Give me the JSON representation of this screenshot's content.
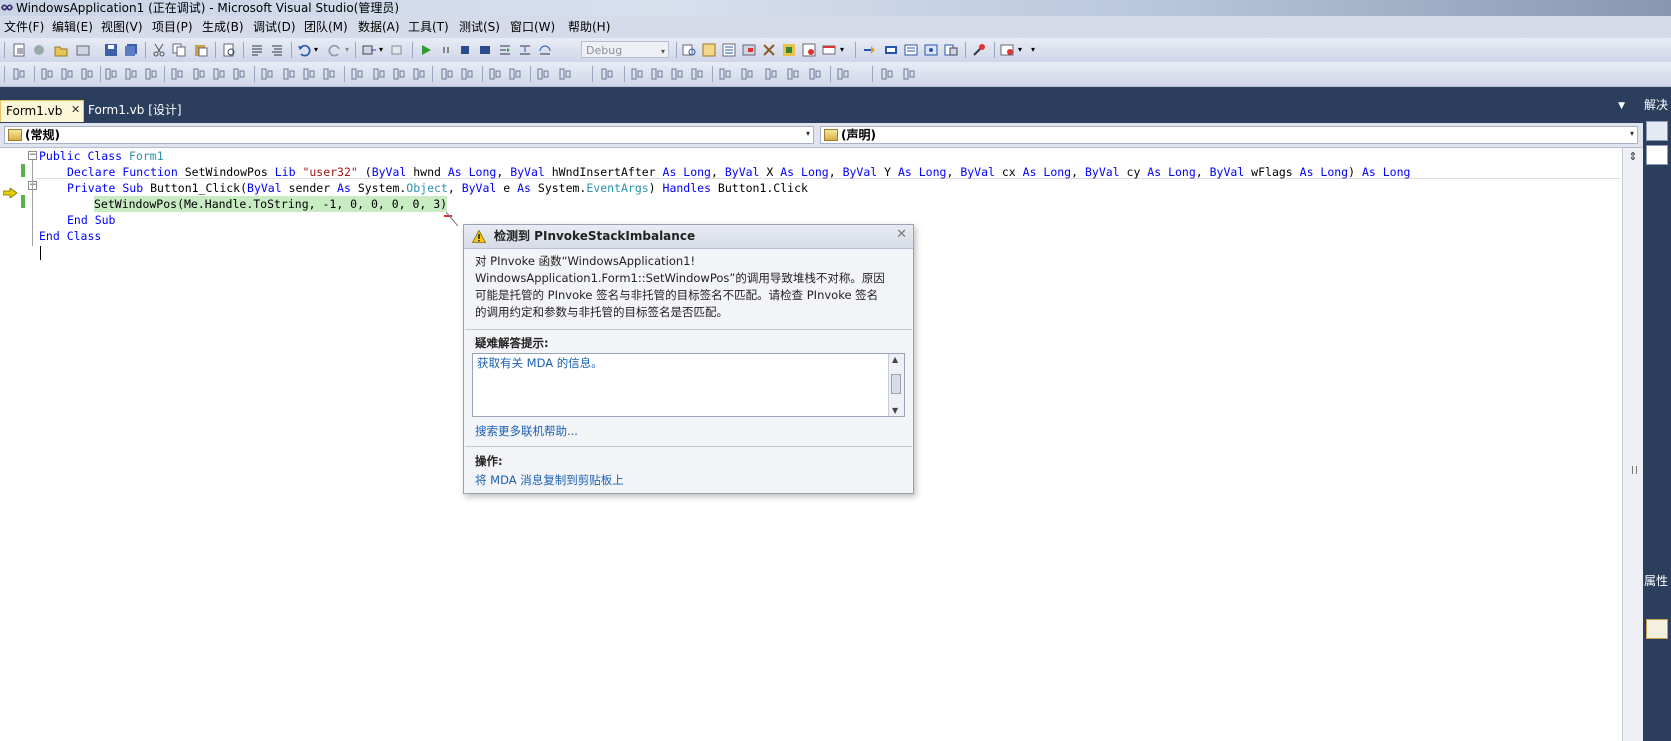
{
  "window": {
    "title": "WindowsApplication1 (正在调试) - Microsoft Visual Studio(管理员)"
  },
  "menu": {
    "items": [
      "文件(F)",
      "编辑(E)",
      "视图(V)",
      "项目(P)",
      "生成(B)",
      "调试(D)",
      "团队(M)",
      "数据(A)",
      "工具(T)",
      "测试(S)",
      "窗口(W)",
      "帮助(H)"
    ]
  },
  "toolbar": {
    "config_value": "Debug"
  },
  "tabs": [
    {
      "label": "Form1.vb"
    },
    {
      "label": "Form1.vb [设计]"
    }
  ],
  "right_panel": {
    "solution_tab": "解决",
    "properties_tab": "属性"
  },
  "navbar": {
    "left_value": "(常规)",
    "right_value": "(声明)"
  },
  "code": {
    "l1": {
      "kw1": "Public Class ",
      "name": "Form1"
    },
    "l2": {
      "a": "Declare Function",
      "b": " SetWindowPos ",
      "c": "Lib",
      "d": " ",
      "e": "\"user32\"",
      "f": " (",
      "g": "ByVal",
      "h": " hwnd ",
      "i": "As Long",
      "j": ", ",
      "k": "ByVal",
      "l": " hWndInsertAfter ",
      "m": "As Long",
      "n": ", ",
      "o": "ByVal",
      "p": " X ",
      "q": "As Long",
      "r": ", ",
      "s": "ByVal",
      "t": " Y ",
      "u": "As Long",
      "v": ", ",
      "w": "ByVal",
      "x": " cx ",
      "y": "As Long",
      "z": ", ",
      "aa": "ByVal",
      "ab": " cy ",
      "ac": "As Long",
      "ad": ", ",
      "ae": "ByVal",
      "af": " wFlags ",
      "ag": "As Long",
      "ah": ") ",
      "ai": "As Long"
    },
    "l3": {
      "a": "Private Sub",
      "b": " Button1_Click(",
      "c": "ByVal",
      "d": " sender ",
      "e": "As",
      "f": " System.",
      "g": "Object",
      "h": ", ",
      "i": "ByVal",
      "j": " e ",
      "k": "As",
      "l": " System.",
      "m": "EventArgs",
      "n": ") ",
      "o": "Handles",
      "p": " Button1.Click"
    },
    "l4": "SetWindowPos(Me.Handle.ToString, -1, 0, 0, 0, 0, 3)",
    "l5": "End Sub",
    "l6": "End Class"
  },
  "exception": {
    "title": "检测到 PInvokeStackImbalance",
    "message_l1": "对 PInvoke 函数“WindowsApplication1!",
    "message_l2": "WindowsApplication1.Form1::SetWindowPos”的调用导致堆栈不对称。原因",
    "message_l3": "可能是托管的 PInvoke 签名与非托管的目标签名不匹配。请检查 PInvoke 签名",
    "message_l4": "的调用约定和参数与非托管的目标签名是否匹配。",
    "tips_label": "疑难解答提示:",
    "tips": [
      "获取有关 MDA 的信息。"
    ],
    "search_link": "搜索更多联机帮助...",
    "actions_label": "操作:",
    "copy_link": "将 MDA 消息复制到剪贴板上"
  }
}
